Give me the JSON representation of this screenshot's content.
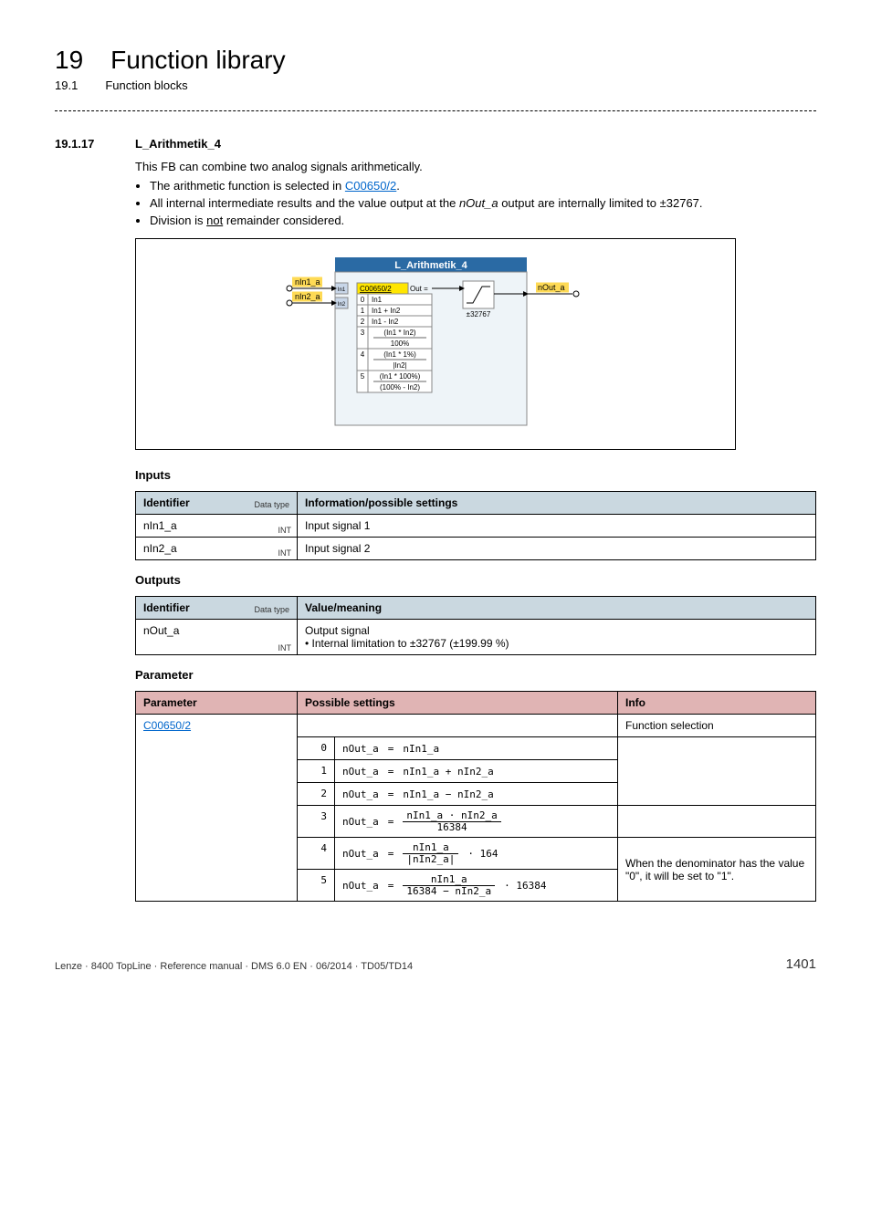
{
  "chapter": {
    "number": "19",
    "title": "Function library"
  },
  "subchapter": {
    "number": "19.1",
    "title": "Function blocks"
  },
  "section": {
    "number": "19.1.17",
    "title": "L_Arithmetik_4"
  },
  "intro": "This FB can combine two analog signals arithmetically.",
  "bullets": {
    "b1_pre": "The arithmetic function is selected in ",
    "b1_link": "C00650/2",
    "b1_post": ".",
    "b2_pre": "All internal intermediate results and the value output at the ",
    "b2_ital": "nOut_a",
    "b2_post": " output are internally limited to ±32767.",
    "b3_pre": "Division is ",
    "b3_und": "not",
    "b3_post": " remainder considered."
  },
  "diagram": {
    "title": "L_Arithmetik_4",
    "in1_label": "nIn1_a",
    "in2_label": "nIn2_a",
    "in1_port": "In1",
    "in2_port": "In2",
    "code_label": "C00650/2",
    "out_eq": " Out =",
    "out_label": "nOut_a",
    "limit_label": "±32767",
    "opts": {
      "n0": "0",
      "t0": "In1",
      "n1": "1",
      "t1": "In1 + In2",
      "n2": "2",
      "t2": "In1 - In2",
      "n3": "3",
      "t3a": "(In1 * In2)",
      "t3b": "100%",
      "n4": "4",
      "t4a": "(In1 * 1%)",
      "t4b": "|In2|",
      "n5": "5",
      "t5a": "(In1 * 100%)",
      "t5b": "(100% - In2)"
    }
  },
  "inputs": {
    "heading": "Inputs",
    "h_identifier": "Identifier",
    "h_datatype": "Data type",
    "h_info": "Information/possible settings",
    "r1_id": "nIn1_a",
    "r1_dt": "INT",
    "r1_info": "Input signal 1",
    "r2_id": "nIn2_a",
    "r2_dt": "INT",
    "r2_info": "Input signal 2"
  },
  "outputs": {
    "heading": "Outputs",
    "h_identifier": "Identifier",
    "h_datatype": "Data type",
    "h_value": "Value/meaning",
    "r1_id": "nOut_a",
    "r1_dt": "INT",
    "r1_v1": "Output signal",
    "r1_v2": "• Internal limitation to ±32767 (±199.99 %)"
  },
  "parameter": {
    "heading": "Parameter",
    "h_param": "Parameter",
    "h_settings": "Possible settings",
    "h_info": "Info",
    "code_link": "C00650/2",
    "info_funcsel": "Function selection",
    "rownums": {
      "n0": "0",
      "n1": "1",
      "n2": "2",
      "n3": "3",
      "n4": "4",
      "n5": "5"
    },
    "formulas": {
      "lhs": "nOut_a",
      "eq": "=",
      "r0": "nIn1_a",
      "r1": "nIn1_a + nIn2_a",
      "r2": "nIn1_a − nIn2_a",
      "r3_num": "nIn1_a ⋅ nIn2_a",
      "r3_den": "16384",
      "r4_num": "nIn1_a",
      "r4_den": "|nIn2_a|",
      "r4_mult": "⋅ 164",
      "r5_num": "nIn1_a",
      "r5_den": "16384 − nIn2_a",
      "r5_mult": "⋅ 16384"
    },
    "note_denominator": "When the denominator has the value \"0\", it will be set to \"1\"."
  },
  "footer": {
    "left": "Lenze · 8400 TopLine · Reference manual · DMS 6.0 EN · 06/2014 · TD05/TD14",
    "page": "1401"
  }
}
